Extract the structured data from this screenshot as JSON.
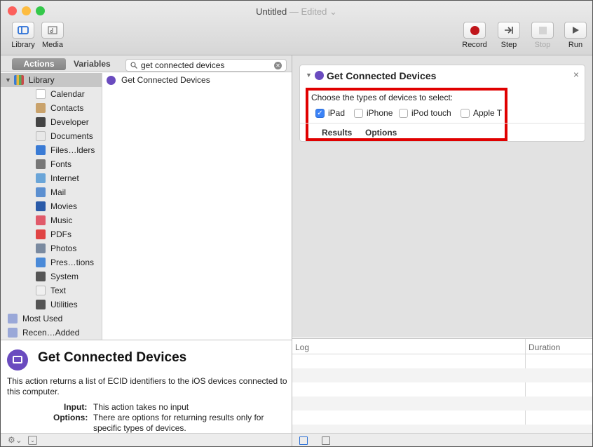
{
  "window": {
    "title": "Untitled",
    "edited": "— Edited ⌄"
  },
  "toolbar": {
    "library": "Library",
    "media": "Media",
    "record": "Record",
    "step": "Step",
    "stop": "Stop",
    "run": "Run"
  },
  "tabs": {
    "actions": "Actions",
    "variables": "Variables"
  },
  "search": {
    "value": "get connected devices"
  },
  "library": {
    "root": "Library",
    "items": [
      "Calendar",
      "Contacts",
      "Developer",
      "Documents",
      "Files…lders",
      "Fonts",
      "Internet",
      "Mail",
      "Movies",
      "Music",
      "PDFs",
      "Photos",
      "Pres…tions",
      "System",
      "Text",
      "Utilities",
      "Most Used",
      "Recen…Added"
    ]
  },
  "actions_list": [
    "Get Connected Devices"
  ],
  "card": {
    "title": "Get Connected Devices",
    "prompt": "Choose the types of devices to select:",
    "options": [
      {
        "label": "iPad",
        "checked": true
      },
      {
        "label": "iPhone",
        "checked": false
      },
      {
        "label": "iPod touch",
        "checked": false
      },
      {
        "label": "Apple T",
        "checked": false
      }
    ],
    "tabs": [
      "Results",
      "Options"
    ],
    "close": "×"
  },
  "description": {
    "title": "Get Connected Devices",
    "body": "This action returns a list of ECID identifiers to the iOS devices connected to this computer.",
    "input_label": "Input:",
    "input_text": "This action takes no input",
    "options_label": "Options:",
    "options_text1": "There are options for returning results only for",
    "options_text2": "specific types of devices."
  },
  "log": {
    "col1": "Log",
    "col2": "Duration"
  },
  "colors": {
    "highlight_box": "#e00000",
    "checkbox_accent": "#3b82f6",
    "action_icon": "#6a4bbf"
  }
}
